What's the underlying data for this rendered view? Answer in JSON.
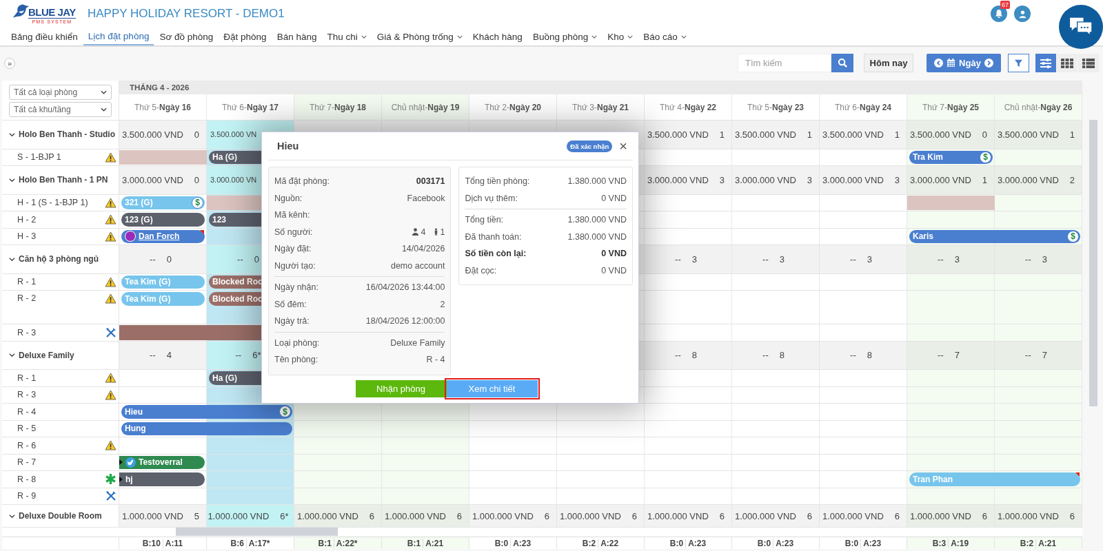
{
  "header": {
    "logo_title": "BLUE JAY",
    "logo_subtitle": "PMS SYSTEM",
    "hotel": "HAPPY HOLIDAY RESORT - DEMO1",
    "notifications": "67"
  },
  "nav": [
    {
      "label": "Bảng điều khiển",
      "selected": false,
      "dropdown": false
    },
    {
      "label": "Lịch đặt phòng",
      "selected": true,
      "dropdown": false
    },
    {
      "label": "Sơ đồ phòng",
      "selected": false,
      "dropdown": false
    },
    {
      "label": "Đặt phòng",
      "selected": false,
      "dropdown": false
    },
    {
      "label": "Bán hàng",
      "selected": false,
      "dropdown": false
    },
    {
      "label": "Thu chi",
      "selected": false,
      "dropdown": true
    },
    {
      "label": "Giá & Phòng trống",
      "selected": false,
      "dropdown": true
    },
    {
      "label": "Khách hàng",
      "selected": false,
      "dropdown": false
    },
    {
      "label": "Buồng phòng",
      "selected": false,
      "dropdown": true
    },
    {
      "label": "Kho",
      "selected": false,
      "dropdown": true
    },
    {
      "label": "Báo cáo",
      "selected": false,
      "dropdown": true
    }
  ],
  "toolbar": {
    "expand": "»",
    "search": {
      "placeholder": "Tìm kiếm"
    },
    "today": "Hôm nay",
    "period": "Ngày",
    "views": [
      {
        "kind": "sliders",
        "selected": true
      },
      {
        "kind": "grid",
        "selected": false
      },
      {
        "kind": "list",
        "selected": false
      }
    ]
  },
  "filters": [
    {
      "value": "Tất cả loại phòng"
    },
    {
      "value": "Tất cả khu/tầng"
    }
  ],
  "month": "THÁNG 4 - 2026",
  "days": [
    {
      "weekday": "Thứ 5-",
      "date": "Ngày 16",
      "kind": "weekday"
    },
    {
      "weekday": "Thứ 6-",
      "date": "Ngày 17",
      "kind": "today"
    },
    {
      "weekday": "Thứ 7-",
      "date": "Ngày 18",
      "kind": "weekend"
    },
    {
      "weekday": "Chủ nhật-",
      "date": "Ngày 19",
      "kind": "weekend"
    },
    {
      "weekday": "Thứ 2-",
      "date": "Ngày 20",
      "kind": "weekday"
    },
    {
      "weekday": "Thứ 3-",
      "date": "Ngày 21",
      "kind": "weekday"
    },
    {
      "weekday": "Thứ 4-",
      "date": "Ngày 22",
      "kind": "weekday"
    },
    {
      "weekday": "Thứ 5-",
      "date": "Ngày 23",
      "kind": "weekday"
    },
    {
      "weekday": "Thứ 6-",
      "date": "Ngày 24",
      "kind": "weekday"
    },
    {
      "weekday": "Thứ 7-",
      "date": "Ngày 25",
      "kind": "weekend"
    },
    {
      "weekday": "Chủ nhật-",
      "date": "Ngày 26",
      "kind": "weekend"
    }
  ],
  "rows": [
    {
      "kind": "group",
      "name": "Holo Ben Thanh - Studio",
      "expanded": true,
      "cells": [
        {
          "price": "3.500.000 VND",
          "count": "0"
        },
        {
          "price": "3.500.000 VN"
        },
        null,
        null,
        null,
        null,
        {
          "price": "3.500.000 VND",
          "count": "1"
        },
        {
          "price": "3.500.000 VND",
          "count": "1"
        },
        {
          "price": "3.500.000 VND",
          "count": "1"
        },
        {
          "price": "3.500.000 VND",
          "count": "0"
        },
        {
          "price": "3.500.000 VND",
          "count": "1"
        }
      ]
    },
    {
      "kind": "warning-room",
      "name": "S - 1-BJP 1",
      "tall": false,
      "cells": [
        {
          "kind": "blocked"
        },
        {
          "kind": "bar",
          "label": "Ha (G)",
          "color": "#5d616c",
          "continued": false,
          "link": false
        },
        {
          "kind": "stay"
        },
        null,
        null,
        null,
        null,
        null,
        null,
        {
          "kind": "bar",
          "label": "Tra Kim",
          "color": "#4a7fd0",
          "continued": false,
          "link": false,
          "flag": false,
          "badge": "$"
        },
        null
      ]
    },
    {
      "kind": "group",
      "name": "Holo Ben Thanh - 1 PN",
      "expanded": true,
      "cells": [
        {
          "price": "3.000.000 VND",
          "count": "0"
        },
        {
          "price": "3.000.000 VN"
        },
        null,
        null,
        null,
        null,
        {
          "price": "3.000.000 VND",
          "count": "3"
        },
        {
          "price": "3.000.000 VND",
          "count": "3"
        },
        {
          "price": "3.000.000 VND",
          "count": "3"
        },
        {
          "price": "3.000.000 VND",
          "count": "1"
        },
        {
          "price": "3.000.000 VND",
          "count": "2"
        }
      ]
    },
    {
      "kind": "warning-room",
      "name": "H - 1 (S - 1-BJP 1)",
      "tall": false,
      "cells": [
        {
          "kind": "bar",
          "label": "321 (G)",
          "color": "#77c5ec",
          "continued": false,
          "link": false,
          "flag": false,
          "badge": "$"
        },
        {
          "kind": "blocked"
        },
        null,
        null,
        null,
        null,
        null,
        null,
        null,
        {
          "kind": "blocked"
        },
        null
      ]
    },
    {
      "kind": "warning-room",
      "name": "H - 2",
      "tall": false,
      "cells": [
        {
          "kind": "bar",
          "label": "123 (G)",
          "color": "#5d616c",
          "continued": false,
          "link": false,
          "flag": false
        },
        {
          "kind": "bar",
          "label": "123",
          "color": "#5d616c",
          "continued": false,
          "link": false
        },
        {
          "kind": "stay"
        }
      ]
    },
    {
      "kind": "warning-room",
      "name": "H - 3",
      "tall": false,
      "cells": [
        {
          "kind": "avatar-bar",
          "label": "Dan Forch",
          "color": "#4a7fd0",
          "continued": false,
          "link": true,
          "flag": true
        },
        null,
        null,
        null,
        null,
        null,
        null,
        null,
        null,
        {
          "kind": "bar",
          "label": "Karis",
          "color": "#4a7fd0",
          "continued": false,
          "link": false,
          "flag": false,
          "badge": "$"
        },
        {
          "kind": "stay"
        }
      ]
    },
    {
      "kind": "group",
      "name": "Căn hộ 3 phòng ngủ",
      "expanded": true,
      "cells": [
        {
          "price": "--",
          "count": "0"
        },
        {
          "price": "--",
          "count": "0"
        },
        null,
        null,
        null,
        null,
        {
          "price": "--",
          "count": "3"
        },
        {
          "price": "--",
          "count": "3"
        },
        {
          "price": "--",
          "count": "3"
        },
        {
          "price": "--",
          "count": "3"
        },
        {
          "price": "--",
          "count": "3"
        }
      ]
    },
    {
      "kind": "warning-room",
      "name": "R - 1",
      "tall": false,
      "cells": [
        {
          "kind": "bar",
          "label": "Tea Kim (G)",
          "color": "#77c5ec",
          "continued": false,
          "link": false,
          "flag": false
        },
        {
          "kind": "bar",
          "label": "Blocked Roo",
          "color": "#9b6f68",
          "continued": false,
          "link": false
        },
        {
          "kind": "stay"
        }
      ]
    },
    {
      "kind": "warning-room",
      "name": "R - 2",
      "tall": true,
      "cells": [
        {
          "kind": "bar",
          "label": "Tea Kim (G)",
          "color": "#77c5ec",
          "continued": false,
          "link": false,
          "flag": false
        },
        {
          "kind": "bar",
          "label": "Blocked Roo",
          "color": "#9b6f68",
          "continued": false,
          "link": false
        },
        {
          "kind": "stay"
        }
      ]
    },
    {
      "kind": "maintenance-room",
      "name": "R - 3",
      "tall": false,
      "cells": [
        {
          "kind": "maintenance-bar",
          "color": "#9b6f68",
          "continued": false
        },
        {
          "kind": "stay"
        },
        {
          "kind": "stay"
        }
      ]
    },
    {
      "kind": "group",
      "name": "Deluxe Family",
      "expanded": true,
      "cells": [
        {
          "price": "--",
          "count": "4"
        },
        {
          "price": "--",
          "count": "6*"
        },
        null,
        null,
        null,
        null,
        {
          "price": "--",
          "count": "8"
        },
        {
          "price": "--",
          "count": "8"
        },
        {
          "price": "--",
          "count": "8"
        },
        {
          "price": "--",
          "count": "7"
        },
        {
          "price": "--",
          "count": "7"
        }
      ]
    },
    {
      "kind": "warning-room",
      "name": "R - 1",
      "tall": false,
      "cells": [
        null,
        {
          "kind": "bar",
          "label": "Ha (G)",
          "color": "#5d616c",
          "continued": false,
          "link": false
        },
        {
          "kind": "stay"
        }
      ]
    },
    {
      "kind": "warning-room",
      "name": "R - 3",
      "tall": false
    },
    {
      "kind": "room",
      "name": "R - 4",
      "tall": false,
      "cells": [
        {
          "kind": "bar",
          "label": "Hieu",
          "color": "#4a7fd0",
          "continued": false,
          "link": false,
          "flag": false,
          "badge": "$"
        },
        {
          "kind": "stay"
        }
      ]
    },
    {
      "kind": "room",
      "name": "R - 5",
      "tall": false,
      "cells": [
        {
          "kind": "bar",
          "label": "Hung",
          "color": "#4a7fd0",
          "continued": false,
          "link": false,
          "flag": false
        },
        {
          "kind": "stay"
        }
      ]
    },
    {
      "kind": "warning-room",
      "name": "R - 6",
      "tall": false
    },
    {
      "kind": "room",
      "name": "R - 7",
      "tall": false,
      "cells": [
        {
          "kind": "bird-bar",
          "label": "Testoverral",
          "color": "#2f8a4f",
          "continued": true,
          "link": false,
          "flag": false
        }
      ]
    },
    {
      "kind": "flagged-room",
      "name": "R - 8",
      "tall": false,
      "cells": [
        {
          "kind": "bar",
          "label": "hj",
          "color": "#5d616c",
          "continued": true,
          "link": false,
          "flag": false
        },
        null,
        null,
        null,
        null,
        null,
        null,
        null,
        null,
        {
          "kind": "bar",
          "label": "Tran Phan",
          "color": "#77c5ec",
          "continued": false,
          "link": false,
          "flag": true
        },
        {
          "kind": "stay"
        }
      ]
    },
    {
      "kind": "maintenance-room",
      "name": "R - 9",
      "tall": false
    },
    {
      "kind": "group",
      "name": "Deluxe Double Room",
      "expanded": true,
      "cells": [
        {
          "price": "1.000.000 VND",
          "count": "5"
        },
        {
          "price": "1.000.000 VND",
          "count": "6*"
        },
        {
          "price": "1.000.000 VND",
          "count": "6"
        },
        {
          "price": "1.000.000 VND",
          "count": "6"
        },
        {
          "price": "1.000.000 VND",
          "count": "6"
        },
        {
          "price": "1.000.000 VND",
          "count": "6"
        },
        {
          "price": "1.000.000 VND",
          "count": "6"
        },
        {
          "price": "1.000.000 VND",
          "count": "6"
        },
        {
          "price": "1.000.000 VND",
          "count": "6"
        },
        {
          "price": "1.000.000 VND",
          "count": "6"
        },
        {
          "price": "1.000.000 VND",
          "count": "6"
        }
      ]
    }
  ],
  "totals": [
    {
      "b": "B:10",
      "a": "A:11"
    },
    {
      "b": "B:6",
      "a": "A:17*"
    },
    {
      "b": "B:1",
      "a": "A:22*"
    },
    {
      "b": "B:1",
      "a": "A:21"
    },
    {
      "b": "B:0",
      "a": "A:23"
    },
    {
      "b": "B:2",
      "a": "A:22"
    },
    {
      "b": "B:0",
      "a": "A:23"
    },
    {
      "b": "B:0",
      "a": "A:23"
    },
    {
      "b": "B:0",
      "a": "A:23"
    },
    {
      "b": "B:3",
      "a": "A:19"
    },
    {
      "b": "B:2",
      "a": "A:21"
    }
  ],
  "modal": {
    "title": "Hieu",
    "status": "Đã xác nhận",
    "close": "×",
    "details": [
      [
        {
          "label": "Mã đặt phòng:",
          "value": "003171",
          "kind": "strong"
        },
        {
          "label": "Nguồn:",
          "value": "Facebook",
          "kind": "text"
        },
        {
          "label": "Mã kênh:",
          "kind": "text"
        },
        {
          "label": "Số người:",
          "kind": "guests",
          "adults": "4",
          "children": "1"
        },
        {
          "label": "Ngày đặt:",
          "value": "14/04/2026",
          "kind": "text"
        },
        {
          "label": "Người tạo:",
          "value": "demo account",
          "kind": "text"
        }
      ],
      [
        {
          "label": "Ngày nhận:",
          "value": "16/04/2026 13:44:00",
          "kind": "text"
        },
        {
          "label": "Số đêm:",
          "value": "2",
          "kind": "text"
        },
        {
          "label": "Ngày trả:",
          "value": "18/04/2026 12:00:00",
          "kind": "text"
        }
      ],
      [
        {
          "label": "Loại phòng:",
          "value": "Deluxe Family",
          "kind": "text"
        },
        {
          "label": "Tên phòng:",
          "value": "R - 4",
          "kind": "text"
        }
      ]
    ],
    "payments": [
      [
        {
          "label": "Tổng tiền phòng:",
          "value": "1.380.000 VND",
          "kind": "text"
        },
        {
          "label": "Dịch vụ thêm:",
          "value": "0 VND",
          "kind": "text"
        }
      ],
      [
        {
          "label": "Tổng tiền:",
          "value": "1.380.000 VND",
          "kind": "text"
        },
        {
          "label": "Đã thanh toán:",
          "value": "1.380.000 VND",
          "kind": "text"
        },
        {
          "label": "Số tiền còn lại:",
          "value": "0 VND",
          "kind": "total"
        },
        {
          "label": "Đặt cọc:",
          "value": "0 VND",
          "kind": "text"
        }
      ]
    ],
    "actions": [
      {
        "label": "Nhận phòng",
        "kind": "checkin",
        "highlighted": false
      },
      {
        "label": "Xem chi tiết",
        "kind": "details",
        "highlighted": true
      }
    ]
  }
}
